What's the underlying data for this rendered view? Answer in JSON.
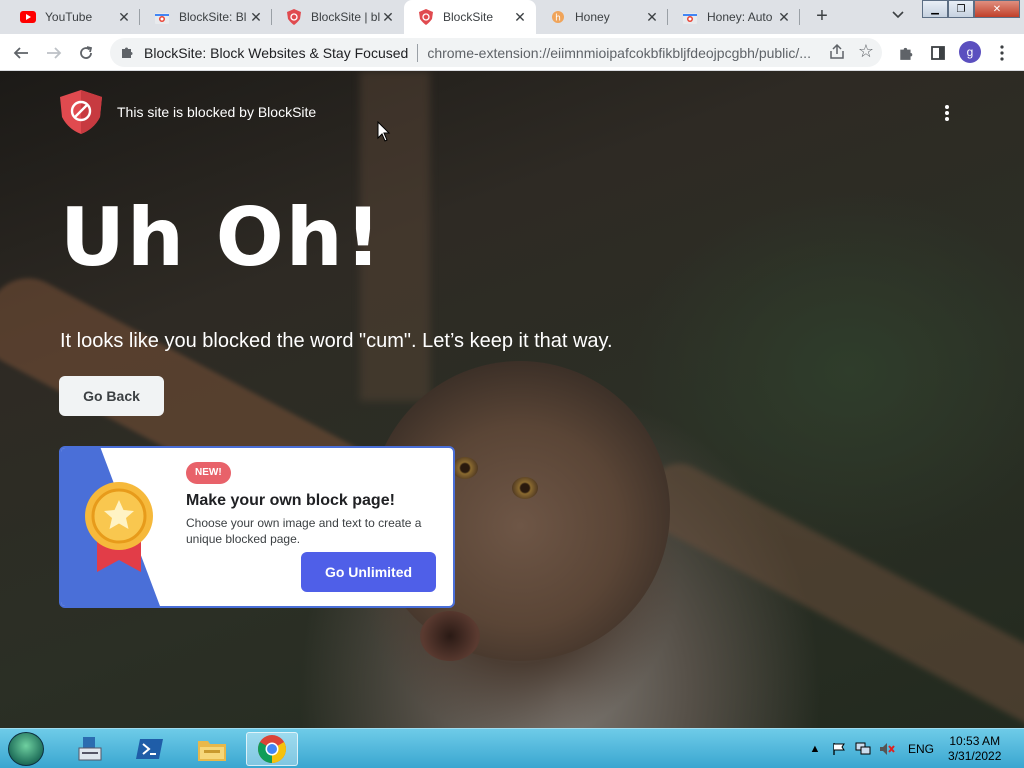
{
  "browser": {
    "tabs": [
      {
        "title": "YouTube",
        "icon": "youtube-icon",
        "active": false
      },
      {
        "title": "BlockSite: Bl",
        "icon": "chrome-webstore-icon",
        "active": false
      },
      {
        "title": "BlockSite | bl",
        "icon": "blocksite-icon",
        "active": false
      },
      {
        "title": "BlockSite",
        "icon": "blocksite-icon",
        "active": true
      },
      {
        "title": "Honey",
        "icon": "honey-icon",
        "active": false
      },
      {
        "title": "Honey: Auto",
        "icon": "chrome-webstore-icon",
        "active": false
      }
    ],
    "new_tab_label": "+",
    "omnibox": {
      "site_name": "BlockSite: Block Websites & Stay Focused",
      "url": "chrome-extension://eiimnmioipafcokbfikbljfdeojpcgbh/public/..."
    },
    "profile_initial": "g"
  },
  "page": {
    "brand_text": "This site is blocked by BlockSite",
    "headline": "Uh Oh!",
    "subtitle": "It looks like you blocked the word \"cum\". Let’s keep it that way.",
    "go_back_label": "Go Back",
    "promo": {
      "badge": "NEW!",
      "title": "Make your own block page!",
      "description": "Choose your own image and text to create a unique blocked page.",
      "button_label": "Go Unlimited"
    }
  },
  "taskbar": {
    "language": "ENG",
    "time": "10:53 AM",
    "date": "3/31/2022"
  },
  "colors": {
    "accent_blue": "#4f5fe8",
    "badge_red": "#e8626a",
    "shield_red": "#e04a4f"
  }
}
